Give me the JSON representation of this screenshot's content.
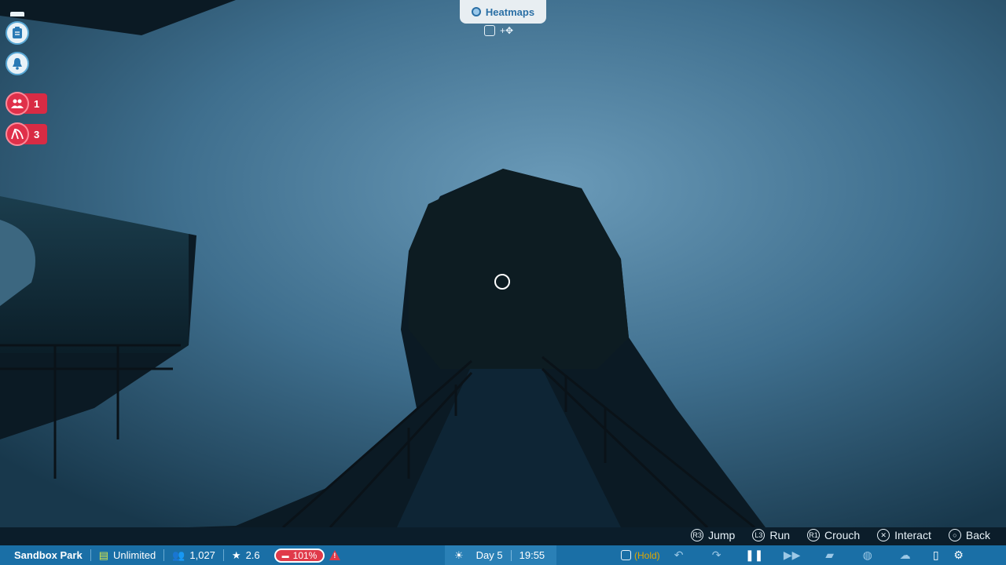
{
  "heatmaps": {
    "label": "Heatmaps"
  },
  "alerts": [
    {
      "icon": "guests-icon",
      "count": "1"
    },
    {
      "icon": "rides-icon",
      "count": "3"
    }
  ],
  "controls": [
    {
      "glyph": "R3",
      "label": "Jump"
    },
    {
      "glyph": "L3",
      "label": "Run"
    },
    {
      "glyph": "R1",
      "label": "Crouch"
    },
    {
      "glyph": "✕",
      "label": "Interact"
    },
    {
      "glyph": "○",
      "label": "Back"
    }
  ],
  "status": {
    "park_name": "Sandbox Park",
    "money": "Unlimited",
    "guests": "1,027",
    "rating": "2.6",
    "percent": "101%",
    "day": "Day 5",
    "time": "19:55",
    "hold": "(Hold)"
  },
  "colors": {
    "bar": "#1a6fa6",
    "alert": "#e0304a",
    "accent": "#2a6fa5"
  }
}
